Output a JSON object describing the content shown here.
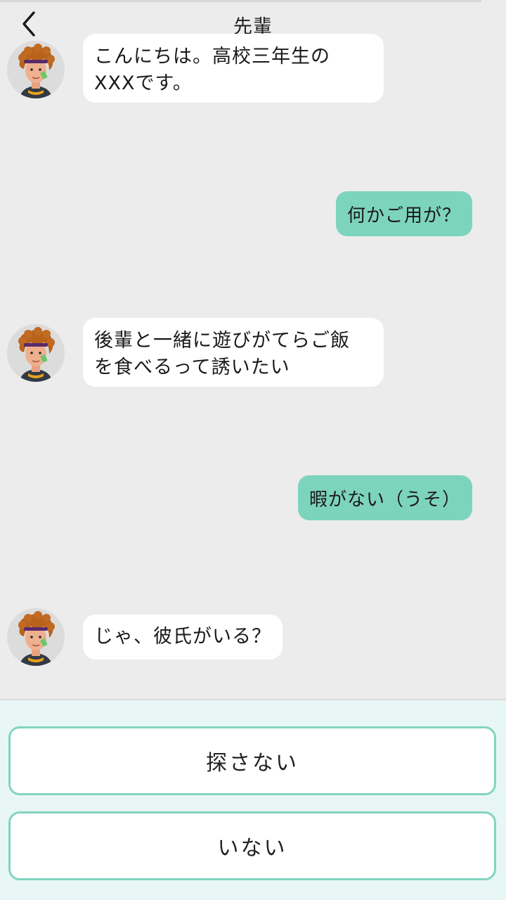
{
  "header": {
    "title": "先輩",
    "back_icon": "chevron-left-icon"
  },
  "messages": [
    {
      "sender": "other",
      "lines": [
        "こんにちは。高校三年生の",
        "XXXです。"
      ]
    },
    {
      "sender": "me",
      "text": "何かご用が？"
    },
    {
      "sender": "other",
      "lines": [
        "後輩と一緒に遊びがてらご飯",
        "を食べるって誘いたい"
      ]
    },
    {
      "sender": "me",
      "text": "暇がない（うそ）"
    },
    {
      "sender": "other",
      "lines": [
        "じゃ、彼氏がいる？"
      ]
    }
  ],
  "choices": [
    {
      "label": "探さない"
    },
    {
      "label": "いない"
    }
  ],
  "colors": {
    "background": "#ececec",
    "outgoing_bubble": "#7dd4bd",
    "incoming_bubble": "#ffffff",
    "choice_border": "#82d5bf",
    "choice_panel": "#e8f6f6"
  }
}
